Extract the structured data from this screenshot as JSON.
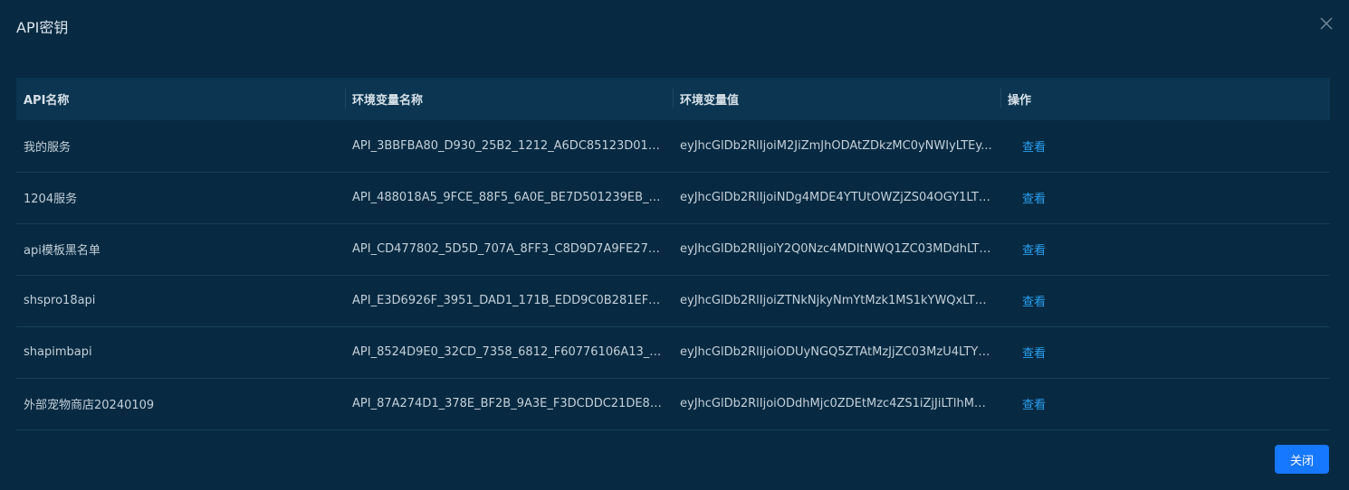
{
  "dialog": {
    "title": "API密钥",
    "close_icon": "close-icon",
    "close_button_label": "关闭"
  },
  "table": {
    "headers": [
      "API名称",
      "环境变量名称",
      "环境变量值",
      "操作"
    ],
    "rows": [
      {
        "name": "我的服务",
        "env_name": "API_3BBFBA80_D930_25B2_1212_A6DC85123D01_C...",
        "env_value": "eyJhcGlDb2RlIjoiM2JiZmJhODAtZDkzMC0yNWIyLTEy...",
        "action": "查看"
      },
      {
        "name": "1204服务",
        "env_name": "API_488018A5_9FCE_88F5_6A0E_BE7D501239EB_CO...",
        "env_value": "eyJhcGlDb2RlIjoiNDg4MDE4YTUtOWZjZS04OGY1LTZ...",
        "action": "查看"
      },
      {
        "name": "api模板黑名单",
        "env_name": "API_CD477802_5D5D_707A_8FF3_C8D9D7A9FE27_C...",
        "env_value": "eyJhcGlDb2RlIjoiY2Q0Nzc4MDItNWQ1ZC03MDdhLTh...",
        "action": "查看"
      },
      {
        "name": "shspro18api",
        "env_name": "API_E3D6926F_3951_DAD1_171B_EDD9C0B281EF_C...",
        "env_value": "eyJhcGlDb2RlIjoiZTNkNjkyNmYtMzk1MS1kYWQxLTE3...",
        "action": "查看"
      },
      {
        "name": "shapimbapi",
        "env_name": "API_8524D9E0_32CD_7358_6812_F60776106A13_C...",
        "env_value": "eyJhcGlDb2RlIjoiODUyNGQ5ZTAtMzJjZC03MzU4LTY4...",
        "action": "查看"
      },
      {
        "name": "外部宠物商店20240109",
        "env_name": "API_87A274D1_378E_BF2B_9A3E_F3DCDDC21DE8_C...",
        "env_value": "eyJhcGlDb2RlIjoiODdhMjc0ZDEtMzc4ZS1iZjJiLTlhM2U...",
        "action": "查看"
      }
    ]
  }
}
